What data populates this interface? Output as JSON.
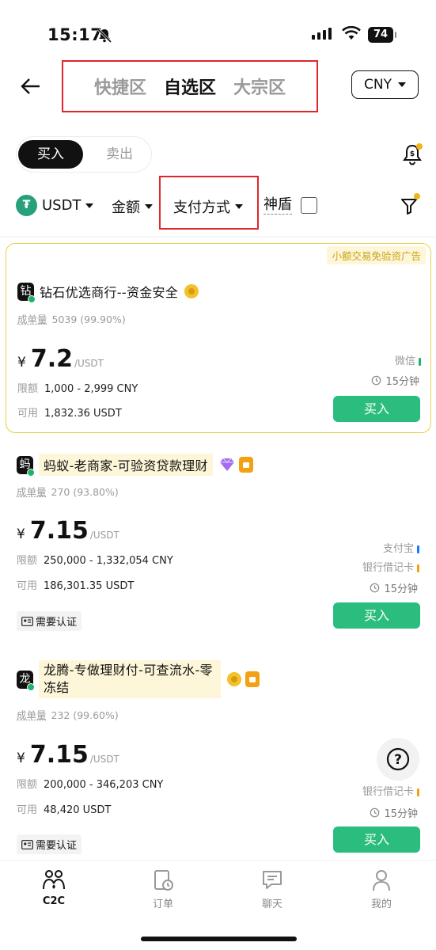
{
  "status": {
    "time": "15:17",
    "battery": "74"
  },
  "topnav": {
    "zones": [
      {
        "label": "快捷区",
        "active": false
      },
      {
        "label": "自选区",
        "active": true
      },
      {
        "label": "大宗区",
        "active": false
      }
    ],
    "currency": "CNY"
  },
  "trade_toggle": {
    "buy": "买入",
    "sell": "卖出"
  },
  "filters": {
    "coin": "USDT",
    "amount": "金额",
    "payment": "支付方式",
    "shield": "神盾"
  },
  "ads": [
    {
      "tag": "小额交易免验资广告",
      "avatar": "钻",
      "name": "钻石优选商行--资金安全",
      "stat_label": "成单量",
      "stat_value": "5039 (99.90%)",
      "currency_symbol": "¥",
      "price": "7.2",
      "unit": "/USDT",
      "limit_label": "限额",
      "limit_value": "1,000 - 2,999 CNY",
      "available_label": "可用",
      "available_value": "1,832.36 USDT",
      "payments": [
        "微信"
      ],
      "time": "15分钟",
      "buy": "买入"
    },
    {
      "avatar": "蚂",
      "name": "蚂蚁-老商家-可验资贷款理财",
      "stat_label": "成单量",
      "stat_value": "270 (93.80%)",
      "currency_symbol": "¥",
      "price": "7.15",
      "unit": "/USDT",
      "limit_label": "限额",
      "limit_value": "250,000 - 1,332,054 CNY",
      "available_label": "可用",
      "available_value": "186,301.35 USDT",
      "payments": [
        "支付宝",
        "银行借记卡"
      ],
      "time": "15分钟",
      "kyc": "需要认证",
      "buy": "买入"
    },
    {
      "avatar": "龙",
      "name": "龙腾-专做理财付-可查流水-零冻结",
      "stat_label": "成单量",
      "stat_value": "232 (99.60%)",
      "currency_symbol": "¥",
      "price": "7.15",
      "unit": "/USDT",
      "limit_label": "限额",
      "limit_value": "200,000 - 346,203 CNY",
      "available_label": "可用",
      "available_value": "48,420 USDT",
      "payments": [
        "银行借记卡"
      ],
      "time": "15分钟",
      "kyc": "需要认证",
      "buy": "买入"
    }
  ],
  "help_fab": "?",
  "bottom_nav": [
    {
      "label": "C2C",
      "icon": "c2c-icon",
      "active": true
    },
    {
      "label": "订单",
      "icon": "orders-icon",
      "active": false
    },
    {
      "label": "聊天",
      "icon": "chat-icon",
      "active": false
    },
    {
      "label": "我的",
      "icon": "profile-icon",
      "active": false
    }
  ],
  "colors": {
    "accent_green": "#2bbd7e",
    "highlight_red": "#e0252b",
    "featured_border": "#e8cf47",
    "online_dot": "#20b26c",
    "notify_dot": "#f3b319"
  }
}
